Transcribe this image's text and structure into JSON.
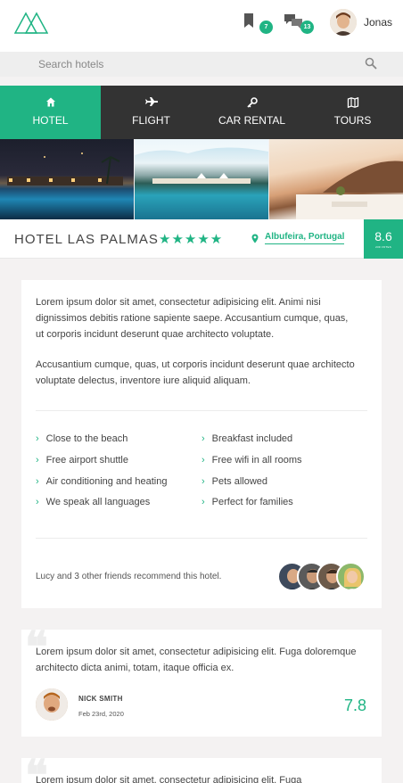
{
  "header": {
    "user_name": "Jonas",
    "bookmarks_count": "7",
    "messages_count": "13",
    "accent": "#20b484",
    "icons": [
      "logo-icon",
      "bookmark-icon",
      "chat-icon"
    ]
  },
  "search": {
    "placeholder": "Search hotels"
  },
  "nav": {
    "items": [
      {
        "label": "HOTEL",
        "icon": "home-icon",
        "active": true
      },
      {
        "label": "FLIGHT",
        "icon": "airplane-icon",
        "active": false
      },
      {
        "label": "CAR RENTAL",
        "icon": "key-icon",
        "active": false
      },
      {
        "label": "TOURS",
        "icon": "map-icon",
        "active": false
      }
    ]
  },
  "hotel": {
    "name": "HOTEL LAS PALMAS",
    "stars": "★★★★★",
    "location": "Albufeira, Portugal",
    "score": "8.6",
    "score_label": "239 VOTES"
  },
  "overview": {
    "paragraph_1": "Lorem ipsum dolor sit amet, consectetur adipisicing elit. Animi nisi dignissimos debitis ratione sapiente saepe. Accusantium cumque, quas, ut corporis incidunt deserunt quae architecto voluptate.",
    "paragraph_2": "Accusantium cumque, quas, ut corporis incidunt deserunt quae architecto voluptate delectus, inventore iure aliquid aliquam.",
    "features": [
      "Close to the beach",
      "Free airport shuttle",
      "Air conditioning and heating",
      "We speak all languages",
      "Breakfast included",
      "Free wifi in all rooms",
      "Pets allowed",
      "Perfect for families"
    ],
    "recommend_text": "Lucy and 3 other friends recommend this hotel."
  },
  "reviews": [
    {
      "text": "Lorem ipsum dolor sit amet, consectetur adipisicing elit. Fuga doloremque architecto dicta animi, totam, itaque officia ex.",
      "name": "NICK SMITH",
      "date": "Feb 23rd, 2020",
      "score": "7.8"
    },
    {
      "text": "Lorem ipsum dolor sit amet, consectetur adipisicing elit. Fuga"
    }
  ]
}
